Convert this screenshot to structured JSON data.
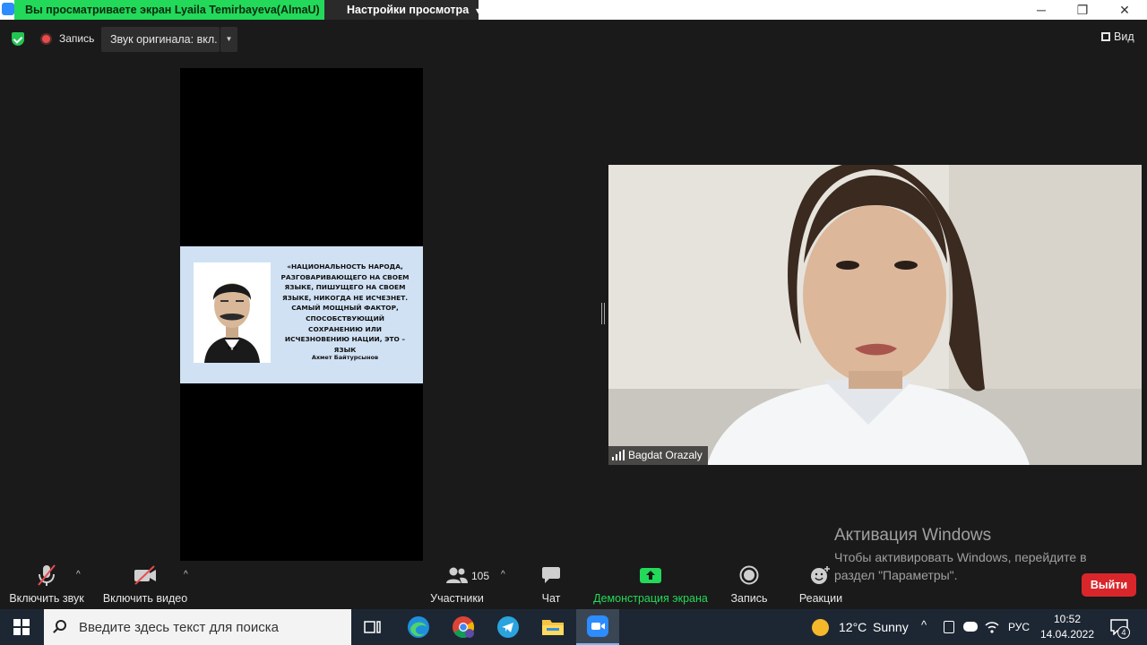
{
  "titlebar": {
    "share_banner": "Вы просматриваете экран Lyaila Temirbayeva(AlmaU)",
    "view_settings": "Настройки просмотра",
    "minimize": "─",
    "restore": "❐",
    "close": "✕"
  },
  "topbar": {
    "recording_label": "Запись",
    "original_sound": "Звук оригинала: вкл.",
    "view_label": "Вид"
  },
  "shared_content": {
    "quote": "«НАЦИОНАЛЬНОСТЬ НАРОДА, РАЗГОВАРИВАЮЩЕГО НА СВОЕМ ЯЗЫКЕ, ПИШУЩЕГО НА СВОЕМ ЯЗЫКЕ, НИКОГДА НЕ ИСЧЕЗНЕТ. САМЫЙ МОЩНЫЙ ФАКТОР, СПОСОБСТВУЮЩИЙ СОХРАНЕНИЮ ИЛИ ИСЧЕЗНОВЕНИЮ НАЦИИ, ЭТО – ЯЗЫК",
    "author": "Ахмет Байтурсынов"
  },
  "video": {
    "participant_name": "Bagdat Orazaly"
  },
  "windows_activation": {
    "title": "Активация Windows",
    "text": "Чтобы активировать Windows, перейдите в раздел \"Параметры\"."
  },
  "controls": {
    "unmute": "Включить звук",
    "start_video": "Включить видео",
    "participants": "Участники",
    "participants_count": "105",
    "chat": "Чат",
    "share_screen": "Демонстрация экрана",
    "record": "Запись",
    "reactions": "Реакции",
    "leave": "Выйти"
  },
  "taskbar": {
    "search_placeholder": "Введите здесь текст для поиска",
    "weather_temp": "12°C",
    "weather_desc": "Sunny",
    "language": "РУС",
    "time": "10:52",
    "date": "14.04.2022",
    "notification_count": "4"
  },
  "colors": {
    "share_green": "#23d959",
    "leave_red": "#d9262a",
    "accent_blue": "#2d8cff"
  }
}
